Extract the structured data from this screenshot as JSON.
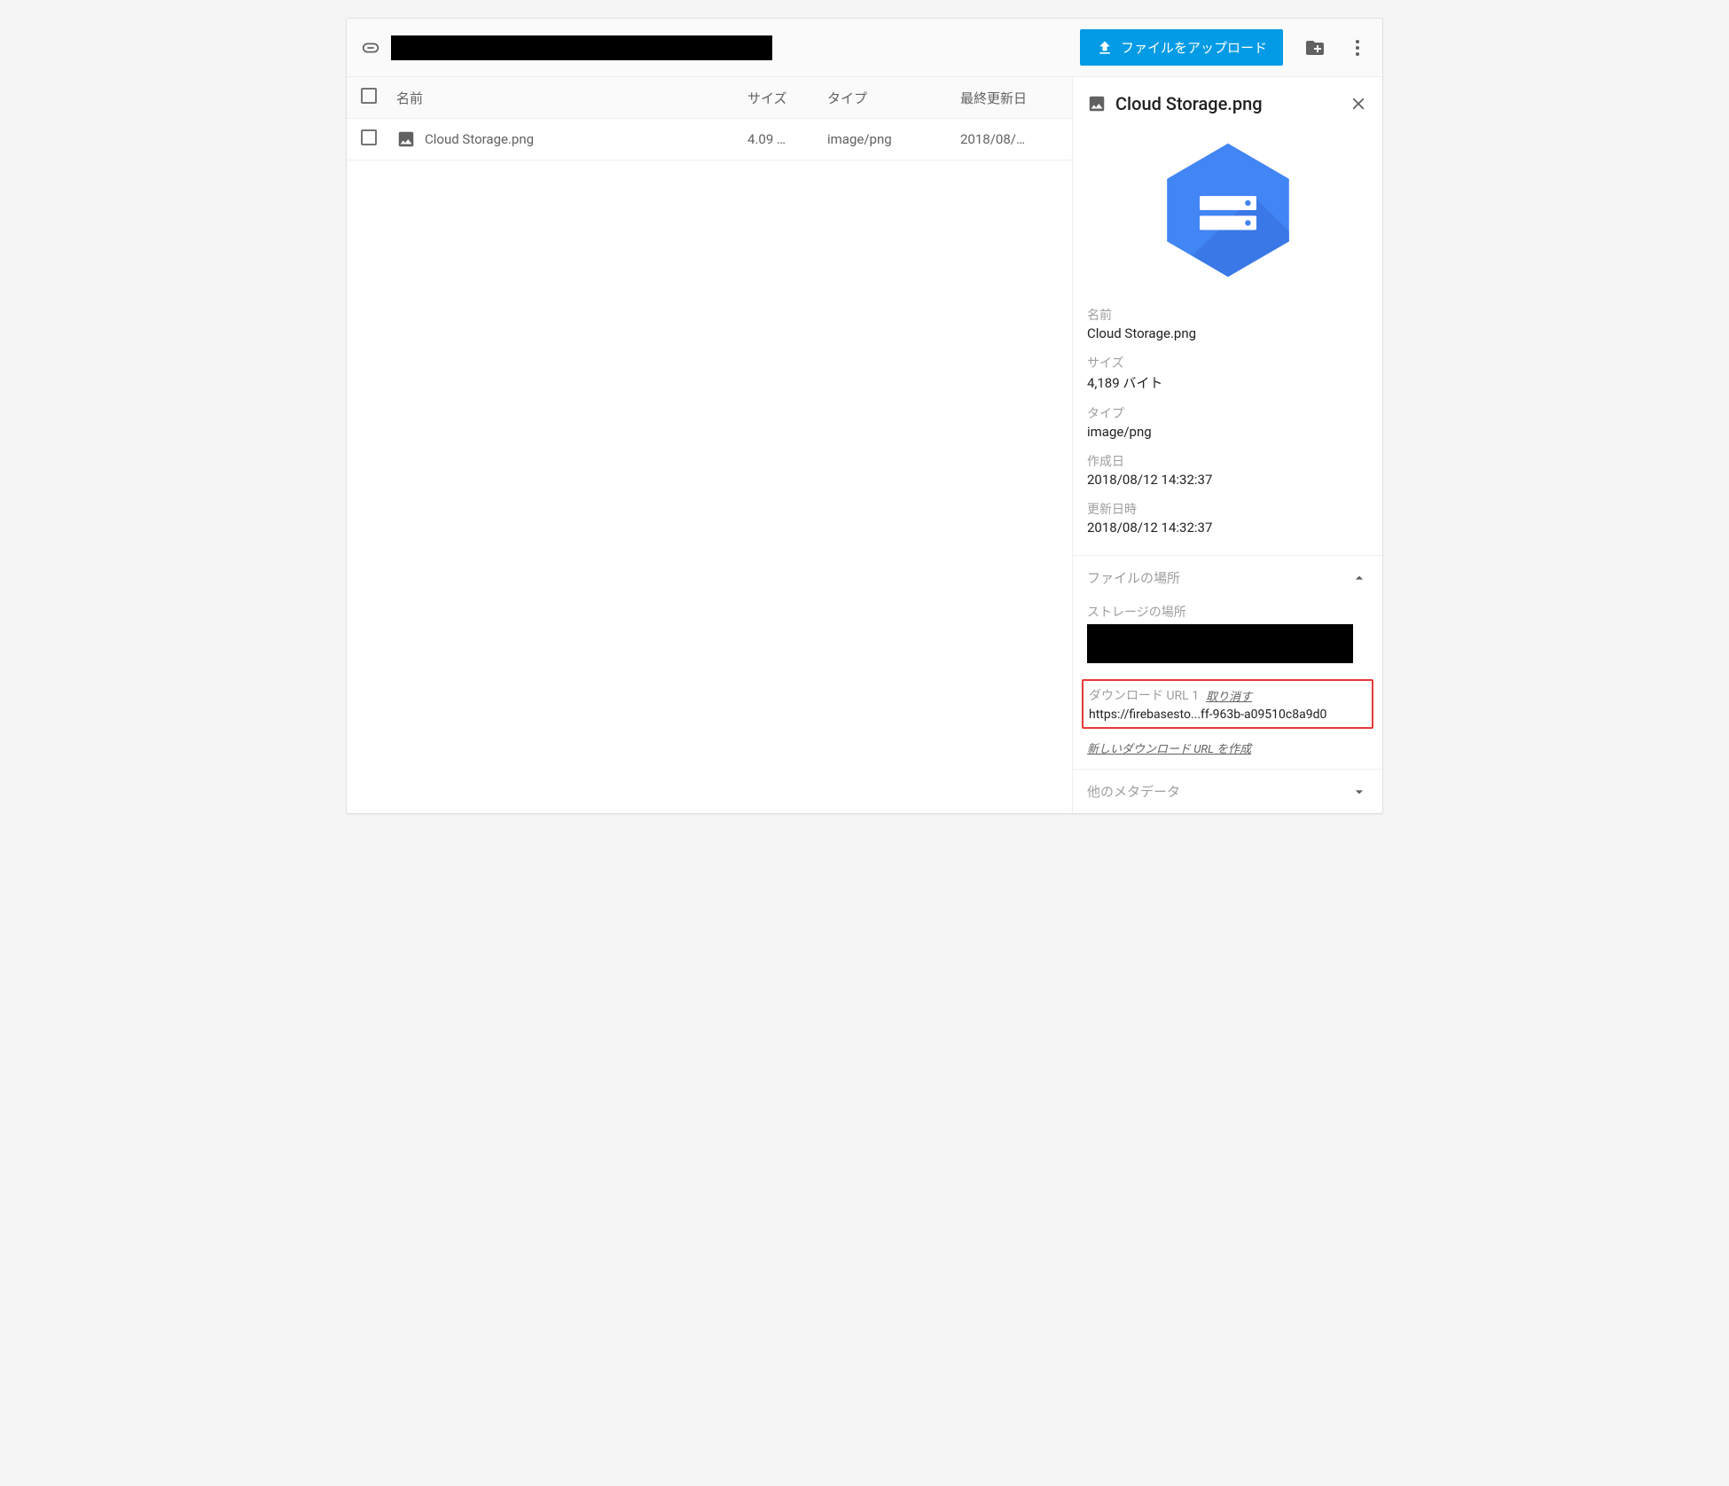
{
  "toolbar": {
    "upload_label": "ファイルをアップロード"
  },
  "columns": {
    "name": "名前",
    "size": "サイズ",
    "type": "タイプ",
    "updated": "最終更新日"
  },
  "row": {
    "name": "Cloud Storage.png",
    "size": "4.09 …",
    "type": "image/png",
    "updated": "2018/08/…"
  },
  "detail": {
    "title": "Cloud Storage.png",
    "name_label": "名前",
    "name_value": "Cloud Storage.png",
    "size_label": "サイズ",
    "size_value": "4,189 バイト",
    "type_label": "タイプ",
    "type_value": "image/png",
    "created_label": "作成日",
    "created_value": "2018/08/12 14:32:37",
    "updated_label": "更新日時",
    "updated_value": "2018/08/12 14:32:37",
    "location_section": "ファイルの場所",
    "storage_loc_label": "ストレージの場所",
    "dl_label": "ダウンロード URL 1",
    "dl_revoke": "取り消す",
    "dl_url": "https://firebasesto...ff-963b-a09510c8a9d0",
    "new_dl": "新しいダウンロード URL を作成",
    "other_meta": "他のメタデータ"
  }
}
